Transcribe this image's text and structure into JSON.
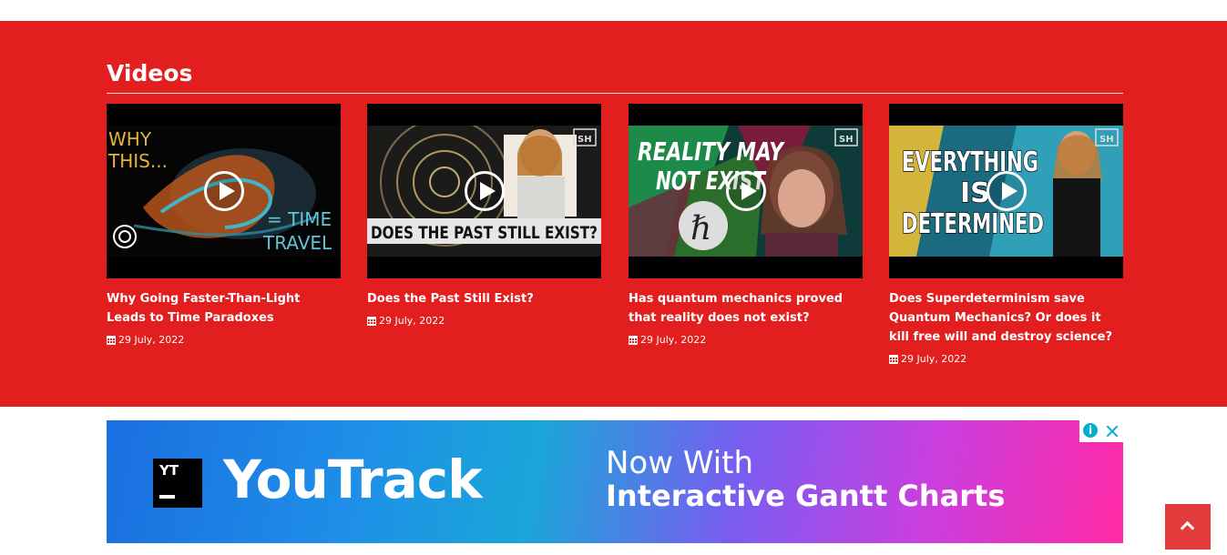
{
  "section": {
    "heading": "Videos"
  },
  "videos": [
    {
      "title": "Why Going Faster-Than-Light Leads to Time Paradoxes",
      "date": "29 July, 2022",
      "thumb_text_1": "WHY",
      "thumb_text_2": "THIS...",
      "thumb_text_3": "= TIME",
      "thumb_text_4": "TRAVEL"
    },
    {
      "title": "Does the Past Still Exist?",
      "date": "29 July, 2022",
      "thumb_text_1": "DOES THE PAST STILL EXIST?",
      "thumb_badge": "SH"
    },
    {
      "title": "Has quantum mechanics proved that reality does not exist?",
      "date": "29 July, 2022",
      "thumb_text_1": "REALITY MAY",
      "thumb_text_2": "NOT EXIST",
      "thumb_symbol": "ℏ",
      "thumb_badge": "SH"
    },
    {
      "title": "Does Superdeterminism save Quantum Mechanics? Or does it kill free will and destroy science?",
      "date": "29 July, 2022",
      "thumb_text_1": "EVERYTHING",
      "thumb_text_2": "IS",
      "thumb_text_3": "DETERMINED",
      "thumb_badge": "SH"
    }
  ],
  "ad": {
    "logo_letters": "YT",
    "brand": "YouTrack",
    "line1": "Now With",
    "line2": "Interactive Gantt Charts"
  },
  "icons": {
    "date": "calendar-icon",
    "play": "play-icon",
    "scroll_top": "chevron-up-icon",
    "ad_info": "info-icon",
    "ad_close": "close-icon"
  },
  "colors": {
    "section_bg": "#e21e1e",
    "scroll_button": "#e23b3b",
    "ad_icon": "#00aecd"
  }
}
